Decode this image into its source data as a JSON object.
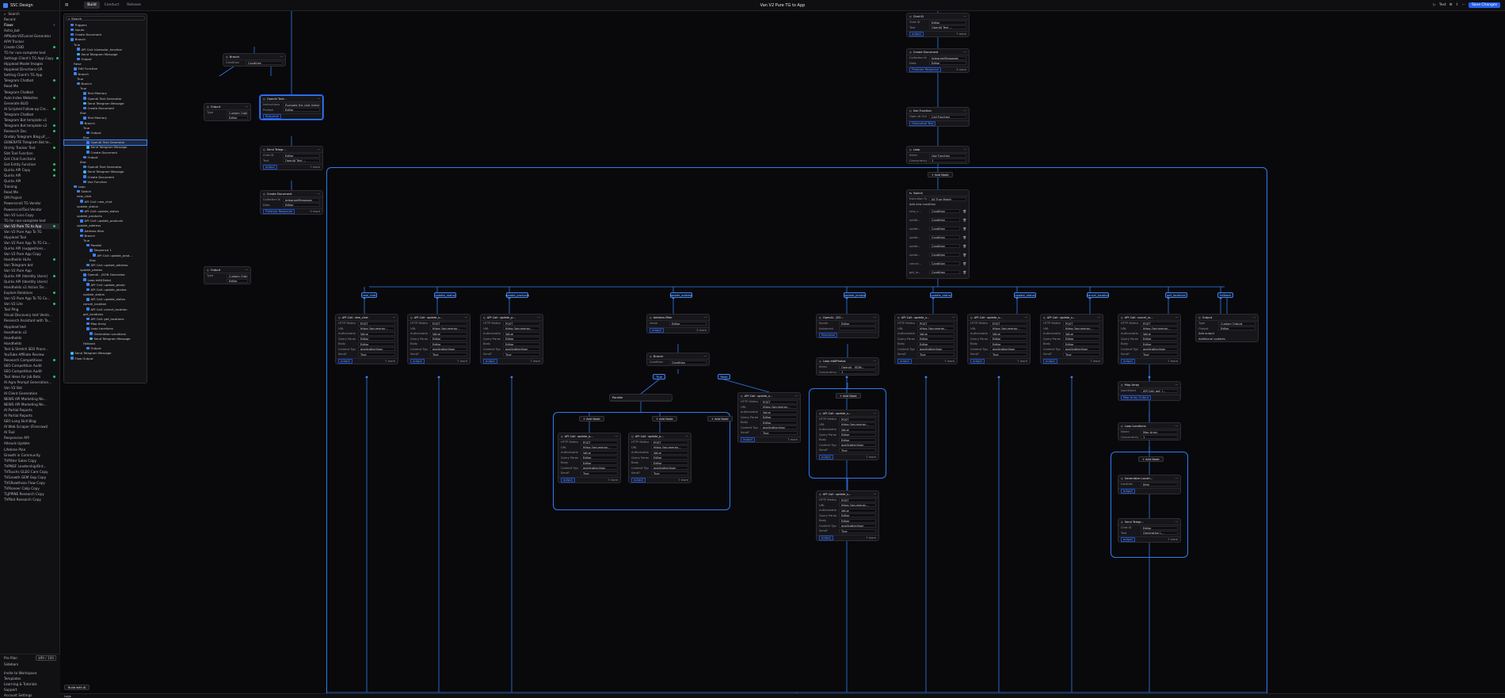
{
  "app": {
    "name": "SSC Design",
    "title": "Van V2 Pure TG to App",
    "tabs": [
      "Build",
      "Conduct",
      "Release"
    ],
    "test_label": "Test",
    "save_label": "Save Changes"
  },
  "sidebar": {
    "search": "Search",
    "recent": "Recent",
    "flows_label": "Flows",
    "items": [
      "Astro_bot",
      "Affiliate-VSFunnel Generator",
      "AFM Tracker",
      "Create CSID",
      "TG for non-complete test",
      "Settings Client's TG App Copy",
      "Hipplead Model Images",
      "Hipplead Directions GR",
      "Setting Client's TG App",
      "Telegram Chatbot",
      "Read Me",
      "Telegram Chatbot",
      "Auto Index Websites",
      "Generate BLID",
      "AI Scripted Follow-up Cre...",
      "Telegram Chatbot",
      "Telegram Bot template v1",
      "Telegram Bot template v2",
      "Research Doc",
      "Ondaly Telegram Blog pF_...",
      "GENERATE Telegram Bot te...",
      "Orchly Tracker Test",
      "Slot Tool Function",
      "Get Chat Functions",
      "Get Entity Function",
      "Quirks API Copy",
      "Quirks API",
      "Quirks API",
      "Training",
      "Read Me",
      "OM Project",
      "Powerscroll TG Vendor",
      "PowerscrollTool Vendor",
      "Van V2 Loco Copy",
      "TG for non-complete test",
      "Van V2 Pure TG to App",
      "Van V2 Pure App To TG",
      "Hipplead Tool",
      "Van V2 Pure App To TG Co...",
      "Quirks API (suggestions...",
      "Van V2 Pure App Copy",
      "Handhelds HLAs",
      "Van Telegram bot",
      "Van V2 Pure App",
      "Quirks API (Identity Users)",
      "Quirks API (Identity Users)",
      "Handhelds v2 Action Ter...",
      "Explore Relations",
      "Van V2 Pure App To TG Co...",
      "Van V2 Lite",
      "Tool Ping",
      "Visual Discovery test Vents...",
      "Research Assistant with Ta...",
      "Hipplead test",
      "Handhelds v2",
      "Handhelds",
      "Handhelds",
      "Test & Stretch SEO Proce...",
      "YouTube Affiliate Review",
      "Research Competitions",
      "SEO Competition Audit",
      "SEO Competition Audit",
      "Tool Ideas for Job Bots",
      "AI Agro Prompt Generation...",
      "Van V2 Bot",
      "AI Client Generation",
      "NEWS API Marketing Ne...",
      "NEWS API Marketing Ne...",
      "AI Partial Reports",
      "AI Partial Reports",
      "SEO Long Skill Blog",
      "AI Web Scraper (Firecrawl)",
      "AI Tool",
      "Responsive API",
      "Allsouls Update",
      "Lifetime Plan",
      "Growth in Community",
      "TVPitter Sales Copy",
      "TVPNSF Leadership/Ont...",
      "TVTouchs GLEO Care Copy",
      "TVGrowth GEM Gap Copy",
      "TVGRowthson Flow Copy",
      "TVPioneer Calip Copy",
      "TLJPPINE Research Copy",
      "TVPilot Research Copy"
    ],
    "plan": "Pro Plan",
    "plan_badge": "$99 / 100",
    "footer": [
      "Sidebars",
      "Invite to Workspace",
      "Templates",
      "Learning & Tutorials",
      "Support",
      "Account Settings"
    ]
  },
  "popup": {
    "search": "Search",
    "rows": [
      "Triggers",
      "Inputs",
      "Create Document",
      "Branch",
      "True",
      "API Call: bluesolar_function",
      "Send Telegram Message",
      "Output",
      "False",
      "Edit Function",
      "Branch",
      "True",
      "Branch",
      "True",
      "Text Memory",
      "OpenAI Text Generator",
      "Send Telegram Message",
      "Create Document",
      "Else",
      "Text Memory",
      "Branch",
      "True",
      "Output",
      "Else",
      "OpenAI Text Generator",
      "Send Telegram Message",
      "Create Document",
      "Output",
      "Else",
      "OpenAI Text Generator",
      "Send Telegram Message",
      "Create Document",
      "Use Function",
      "Loop",
      "Switch",
      "new_chat",
      "API Call: new_chat",
      "update_status",
      "API Call: update_status",
      "update_products",
      "API Call: update_products",
      "update_address",
      "Address filter",
      "Branch",
      "True",
      "Parallel",
      "Sequence 1",
      "API Call: update_prod...",
      "Else",
      "API Call: update_address",
      "update_photos",
      "OpenAI - JSON Generator",
      "Loop edit(Data)",
      "API Call: update_photo",
      "API Call: update_photos",
      "update_status",
      "API Call: update_status",
      "cancel_location",
      "API Call: cancel_location",
      "get_locations",
      "API Call: get_locations",
      "Map Array",
      "Loop Locations",
      "Generation Locations",
      "Send Telegram Message",
      "Fallback",
      "Output",
      "Send Telegram Message",
      "Flow Output"
    ]
  },
  "canvas": {
    "add_node": "+ Add Node",
    "switch": {
      "title": "Switch",
      "execution_type": "Execution Type",
      "execution_value": "All True Match",
      "add_condition": "Add new condition",
      "conditions": [
        "new_c...",
        "updat...",
        "updat...",
        "updat...",
        "updat...",
        "updat...",
        "cancel...",
        "get_lo..."
      ],
      "cond_label": "Condition"
    },
    "top_nodes": [
      {
        "title": "Create Document",
        "rows": [
          [
            "Collection Na...",
            "telegramMessages"
          ],
          [
            "Data",
            "Editor"
          ]
        ],
        "extra": "Additional Settings",
        "footer": "Firestore Response",
        "more": "3 more"
      },
      {
        "title": "Use Function",
        "rows": [
          [
            "Open AI Output",
            "Call Function"
          ]
        ],
        "footer": "Generated Text"
      },
      {
        "title": "Loop",
        "rows": [
          [
            "Items",
            "Use Function"
          ],
          [
            "Concurrency",
            "1"
          ]
        ]
      },
      {
        "title": "Chat ID",
        "rows": [
          [
            "Chat ID",
            "Editor"
          ],
          [
            "Text",
            "OpenAI Text ..."
          ]
        ],
        "footer": "output",
        "more": "7 more"
      }
    ],
    "left_nodes": [
      {
        "title": "OpenAI Text...",
        "rows": [
          [
            "Instructions",
            "Evaluate the chat history..."
          ],
          [
            "Prompt",
            "Editor"
          ]
        ],
        "extra": "Advanced Settings",
        "footer": "Response"
      },
      {
        "title": "Send Telegr...",
        "rows": [
          [
            "Chat ID",
            "Editor"
          ],
          [
            "Text",
            "OpenAI Text ..."
          ]
        ],
        "footer": "output",
        "more": "7 more"
      },
      {
        "title": "Create Document",
        "rows": [
          [
            "Collection Na...",
            "telegramMessages"
          ],
          [
            "Data",
            "Editor"
          ]
        ],
        "extra": "Additional Settings",
        "footer": "Firestore Response",
        "more": "3 more"
      },
      {
        "title": "Branch",
        "rows": [
          [
            "Condition",
            "Condition"
          ]
        ]
      },
      {
        "title": "Output",
        "rows": [
          [
            "Type",
            "Custom Output"
          ],
          [
            "",
            "Editor"
          ]
        ],
        "extra": "Add output"
      }
    ],
    "cases": [
      "new_chat",
      "update_status",
      "update_products",
      "update_address",
      "update_photos",
      "update_status",
      "update_status",
      "cancel_location",
      "get_locations",
      "Fallback"
    ],
    "api_rows": [
      [
        "HTTP Method",
        "POST"
      ],
      [
        "URL",
        "https://anumeron..."
      ],
      [
        "Authorization",
        "Value"
      ],
      [
        "Query Param...",
        "Editor"
      ],
      [
        "Body",
        "Editor"
      ],
      [
        "Content Type",
        "application/json"
      ],
      [
        "Send?",
        "True"
      ]
    ],
    "api_titles": [
      "API Call: new_chat",
      "API Call: update_s...",
      "API Call: update_p...",
      "API Call: update_s...",
      "API Call: update_s...",
      "API Call: update_s...",
      "API Call: cancel_lo...",
      "API Call: get_locati..."
    ],
    "address_filter": {
      "title": "Address filter",
      "rows": [
        [
          "name",
          "Editor"
        ]
      ],
      "footer": "output",
      "more": "3 more"
    },
    "branch2": {
      "title": "Branch",
      "rows": [
        [
          "Condition",
          "Condition"
        ]
      ],
      "true": "True",
      "false": "False"
    },
    "parallel": "Parallel",
    "openai_json": {
      "title": "OpenAI - JSO...",
      "rows": [
        [
          "Inputs",
          "Editor"
        ],
        [
          "Advanced",
          ""
        ]
      ],
      "footer": "Response"
    },
    "loop_edit": {
      "title": "Loop editPhotos",
      "rows": [
        [
          "Items",
          "OpenAI - JSON..."
        ],
        [
          "Concurrency",
          "1"
        ]
      ]
    },
    "output_node": {
      "title": "Output",
      "rows": [
        [
          "Type",
          "Custom Output"
        ],
        [
          "Output",
          "Editor"
        ]
      ],
      "add": "Add output",
      "extra": "Additional updates"
    },
    "map_array": {
      "title": "Map Array",
      "rows": [
        [
          "JsonObject",
          "API Call: get_l..."
        ]
      ],
      "footer": "Map Array Output"
    },
    "loop_locations": {
      "title": "Loop Locations",
      "rows": [
        [
          "Name",
          "Map Array"
        ],
        [
          "Concurrency",
          "1"
        ]
      ]
    },
    "gen_loc": {
      "title": "Generation Locati...",
      "rows": [
        [
          "Location",
          "Item"
        ]
      ],
      "footer": "output"
    },
    "send_tg": {
      "title": "Send Telegr...",
      "rows": [
        [
          "Chat ID",
          "Editor"
        ],
        [
          "Text",
          "Generation L..."
        ]
      ],
      "footer": "output",
      "more": "7 more"
    },
    "switch_cases_top": [
      "False",
      "True"
    ],
    "footer_logs": "Logs",
    "build_ai": "Build with AI"
  },
  "colors": {
    "accent": "#3b82f6",
    "bg": "#0b0b0d",
    "node": "#17171b",
    "green": "#22c55e"
  }
}
